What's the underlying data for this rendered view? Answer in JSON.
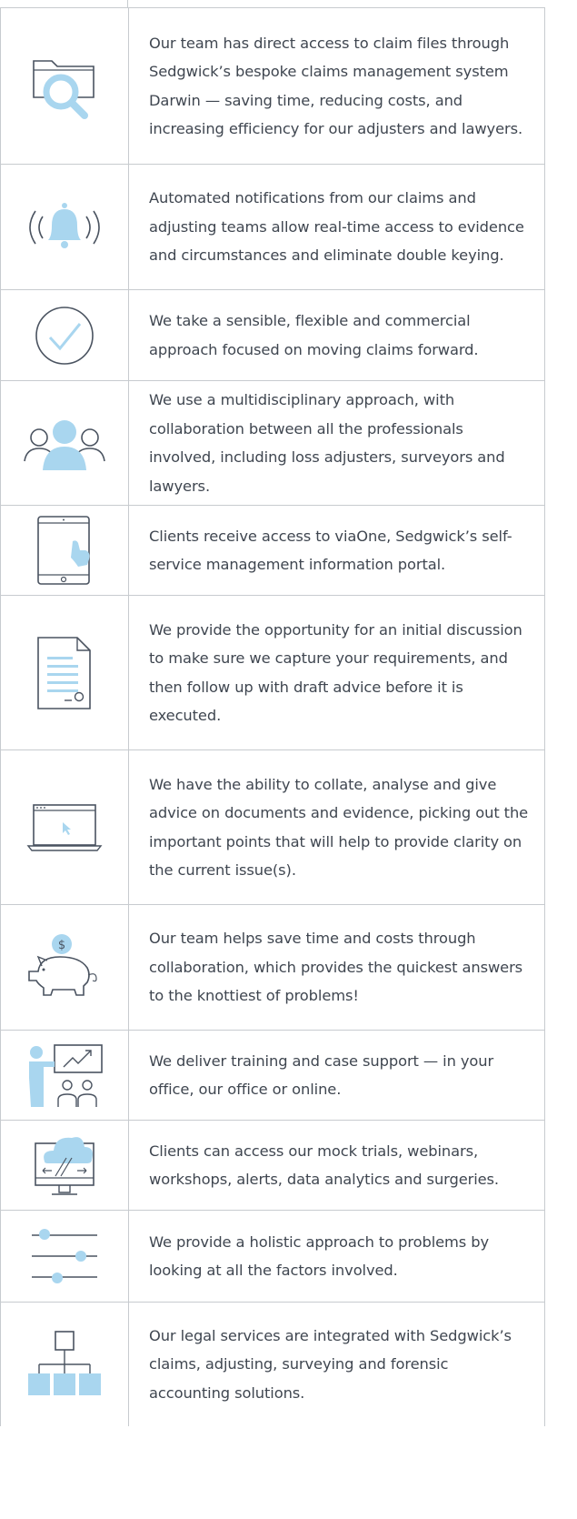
{
  "rows": [
    {
      "icon": "folder-search-icon",
      "text": "Our team has direct access to claim files through Sedgwick’s bespoke claims management system Darwin — saving time, reducing costs, and increasing efficiency for our adjusters and lawyers."
    },
    {
      "icon": "bell-notification-icon",
      "text": "Automated notifications from our claims and adjusting teams allow real-time access to evidence and circumstances and eliminate double keying."
    },
    {
      "icon": "checkmark-circle-icon",
      "text": "We take a sensible, flexible and commercial approach focused on moving claims forward."
    },
    {
      "icon": "people-group-icon",
      "text": "We use a multidisciplinary approach, with collaboration between all the professionals involved, including loss adjusters, surveyors and lawyers."
    },
    {
      "icon": "tablet-touch-icon",
      "text": "Clients receive access to viaOne, Sedgwick’s self-service management information portal."
    },
    {
      "icon": "document-icon",
      "text": "We provide the opportunity for an initial discussion to make sure we capture your requirements, and then follow up with draft advice before it is executed."
    },
    {
      "icon": "laptop-cursor-icon",
      "text": "We have the ability to collate, analyse and give advice on documents and evidence, picking out the important points that will help to provide clarity on the current issue(s)."
    },
    {
      "icon": "piggy-bank-icon",
      "text": "Our team helps save time and costs through collaboration, which provides the quickest answers to the knottiest of problems!"
    },
    {
      "icon": "presentation-training-icon",
      "text": "We deliver training and case support — in your office, our office or online."
    },
    {
      "icon": "cloud-monitor-icon",
      "text": "Clients can access our mock trials, webinars, workshops, alerts, data analytics and surgeries."
    },
    {
      "icon": "sliders-icon",
      "text": "We provide a holistic approach to problems by looking at all the factors involved."
    },
    {
      "icon": "org-chart-icon",
      "text": "Our legal services are integrated with Sedgwick’s claims, adjusting, surveying and forensic accounting solutions."
    }
  ],
  "colors": {
    "accent": "#a9d6ef",
    "line": "#4a5360",
    "border": "#c7cbcf",
    "text": "#3f4650"
  }
}
